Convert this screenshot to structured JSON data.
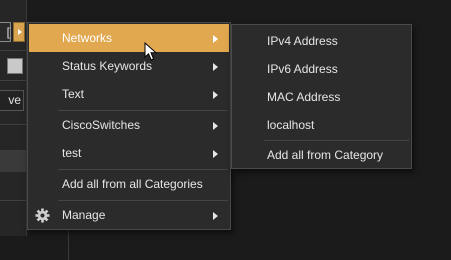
{
  "background": {
    "field_text": "[",
    "input_text": "ve"
  },
  "main_menu": {
    "items": [
      {
        "label": "Networks",
        "has_submenu": true,
        "selected": true
      },
      {
        "label": "Status Keywords",
        "has_submenu": true
      },
      {
        "label": "Text",
        "has_submenu": true
      },
      {
        "label": "CiscoSwitches",
        "has_submenu": true
      },
      {
        "label": "test",
        "has_submenu": true
      },
      {
        "label": "Add all from all Categories",
        "has_submenu": false
      },
      {
        "label": "Manage",
        "has_submenu": true,
        "icon": "gear-icon"
      }
    ]
  },
  "sub_menu": {
    "items": [
      {
        "label": "IPv4 Address"
      },
      {
        "label": "IPv6 Address"
      },
      {
        "label": "MAC Address"
      },
      {
        "label": "localhost"
      },
      {
        "label": "Add all from Category"
      }
    ]
  },
  "colors": {
    "accent": "#e2a84f",
    "menu_bg": "#2b2b2b",
    "page_bg": "#1b1b1b"
  }
}
